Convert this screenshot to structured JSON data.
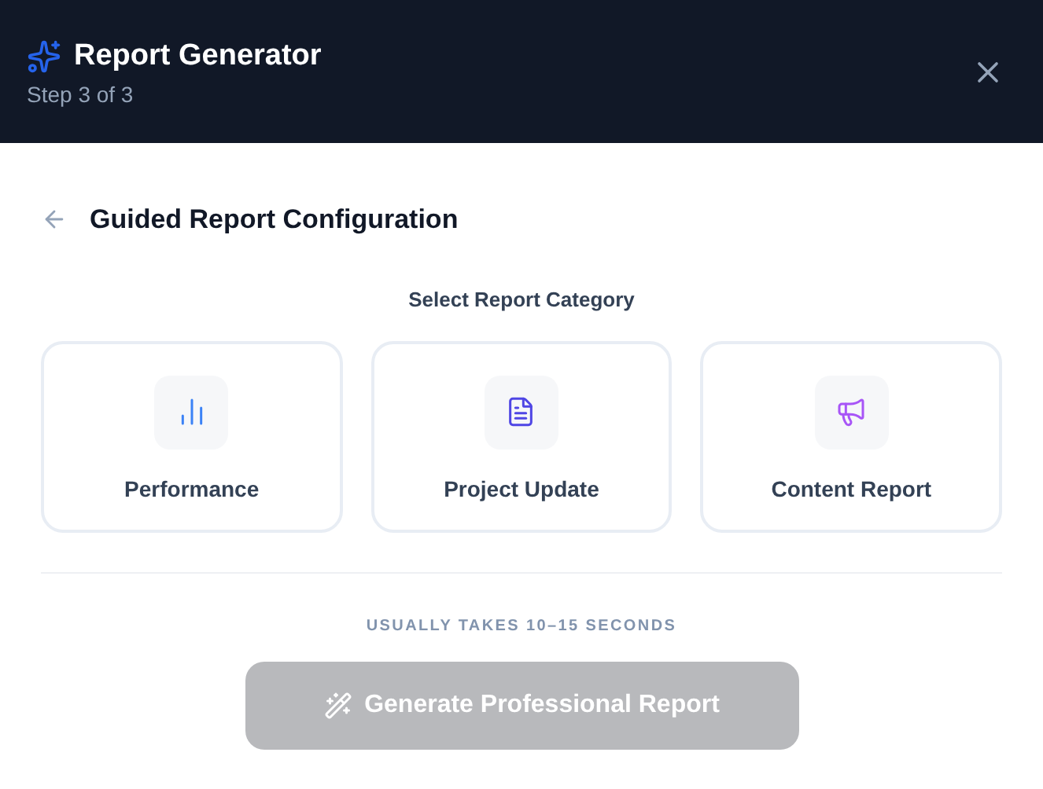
{
  "header": {
    "title": "Report Generator",
    "subtitle": "Step 3 of 3"
  },
  "section": {
    "title": "Guided Report Configuration"
  },
  "category_prompt": "Select Report Category",
  "categories": [
    {
      "label": "Performance",
      "kind": "chart",
      "color": "#3b82f6",
      "selected": false
    },
    {
      "label": "Project Update",
      "kind": "document",
      "color": "#4f46e5",
      "selected": false
    },
    {
      "label": "Content Report",
      "kind": "megaphone",
      "color": "#a855f7",
      "selected": false
    }
  ],
  "hint": "USUALLY TAKES 10–15 SECONDS",
  "generate_button": {
    "label": "Generate Professional Report",
    "disabled": true
  }
}
